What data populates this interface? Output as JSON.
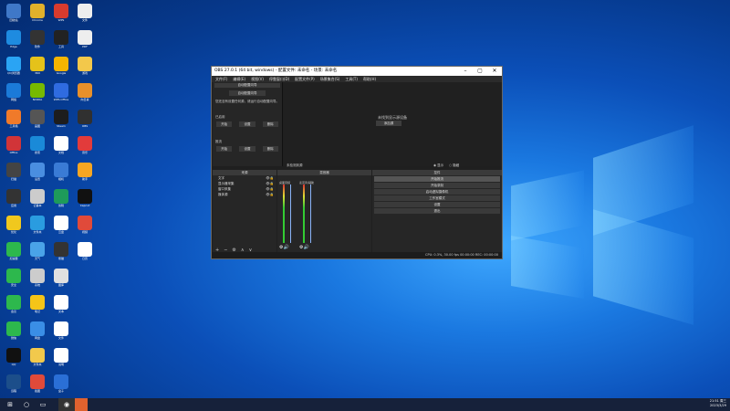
{
  "desktop": {
    "icons": [
      {
        "label": "回收站",
        "color": "#3f78c8"
      },
      {
        "label": "Chrome",
        "color": "#e0b12b"
      },
      {
        "label": "WPS",
        "color": "#d83b2e"
      },
      {
        "label": "文件",
        "color": "#eeeeee"
      },
      {
        "label": "Edge",
        "color": "#1e8be0"
      },
      {
        "label": "软件",
        "color": "#333333"
      },
      {
        "label": "工具",
        "color": "#222222"
      },
      {
        "label": "PDF",
        "color": "#eeeeee"
      },
      {
        "label": "QQ浏览器",
        "color": "#2aa4f4"
      },
      {
        "label": "360",
        "color": "#e5c21a"
      },
      {
        "label": "Google",
        "color": "#f4b400"
      },
      {
        "label": "游戏",
        "color": "#f3c84b"
      },
      {
        "label": "网络",
        "color": "#1b7ad8"
      },
      {
        "label": "NVIDIA",
        "color": "#76b900"
      },
      {
        "label": "WPS Office",
        "color": "#2f6be0"
      },
      {
        "label": "向日葵",
        "color": "#e8902a"
      },
      {
        "label": "工具箱",
        "color": "#f07a2a"
      },
      {
        "label": "画图",
        "color": "#555555"
      },
      {
        "label": "Steam",
        "color": "#1d1d1d"
      },
      {
        "label": "OBS",
        "color": "#303030"
      },
      {
        "label": "Office",
        "color": "#d13438"
      },
      {
        "label": "搜索",
        "color": "#1a8ad8"
      },
      {
        "label": "文档",
        "color": "#ffffff"
      },
      {
        "label": "音乐",
        "color": "#e23b3b"
      },
      {
        "label": "扫描",
        "color": "#444444"
      },
      {
        "label": "设置",
        "color": "#4a8ee0"
      },
      {
        "label": "相机",
        "color": "#3a7bd5"
      },
      {
        "label": "助手",
        "color": "#f6a623"
      },
      {
        "label": "应用",
        "color": "#333333"
      },
      {
        "label": "记事本",
        "color": "#cccccc"
      },
      {
        "label": "剪辑",
        "color": "#1e9b5a"
      },
      {
        "label": "Capcut",
        "color": "#111111"
      },
      {
        "label": "优化",
        "color": "#f0c81e"
      },
      {
        "label": "文件夹",
        "color": "#2a9ce0"
      },
      {
        "label": "云盘",
        "color": "#ffffff"
      },
      {
        "label": "视频",
        "color": "#e04a3a"
      },
      {
        "label": "加速器",
        "color": "#2db84d"
      },
      {
        "label": "天气",
        "color": "#4aa3e8"
      },
      {
        "label": "熊猫",
        "color": "#333333"
      },
      {
        "label": "日历",
        "color": "#ffffff"
      },
      {
        "label": "安全",
        "color": "#2db84d"
      },
      {
        "label": "系统",
        "color": "#cccccc"
      },
      {
        "label": "图库",
        "color": "#e0e0e0"
      },
      {
        "label": "",
        "color": "#00000000"
      },
      {
        "label": "会议",
        "color": "#2db84d"
      },
      {
        "label": "笔记",
        "color": "#f5c518"
      },
      {
        "label": "文本",
        "color": "#ffffff"
      },
      {
        "label": "",
        "color": "#00000000"
      },
      {
        "label": "微信",
        "color": "#2db84d"
      },
      {
        "label": "网盘",
        "color": "#3a8ee6"
      },
      {
        "label": "文件",
        "color": "#ffffff"
      },
      {
        "label": "",
        "color": "#00000000"
      },
      {
        "label": "QQ",
        "color": "#111111"
      },
      {
        "label": "文件夹",
        "color": "#f2c94c"
      },
      {
        "label": "说明",
        "color": "#ffffff"
      },
      {
        "label": "",
        "color": "#00000000"
      },
      {
        "label": "远程",
        "color": "#1c4e8a"
      },
      {
        "label": "截图",
        "color": "#e04a3a"
      },
      {
        "label": "盒子",
        "color": "#2a6fd6"
      },
      {
        "label": "",
        "color": "#00000000"
      }
    ]
  },
  "obs": {
    "title": "OBS 27.0.1 (64 bit, windows) - 配置文件: 未命名 - 场景: 未命名",
    "menu": [
      "文件(F)",
      "编辑(E)",
      "视图(V)",
      "停靠窗口(D)",
      "配置文件(P)",
      "场景集合(S)",
      "工具(T)",
      "帮助(H)"
    ],
    "wizard": {
      "header": "自动配置向导",
      "button": "自动配置向导",
      "description": "您还没有设置任何源，请运行自动配置向导。",
      "section1": "已启用",
      "section2": "推流",
      "buttons_row1": [
        "开始",
        "设置",
        "删除"
      ],
      "buttons_row2": [
        "开始",
        "设置",
        "删除"
      ]
    },
    "preview": {
      "message": "未找到显示源设备",
      "button": "添加源"
    },
    "status_line": {
      "left": "未检测到源",
      "radio1": "显示",
      "radio2": "隐藏"
    },
    "docks": {
      "scenes_title": "来源",
      "mixer_title": "混音器",
      "controls_title": "控件"
    },
    "sources": [
      {
        "label": "文字"
      },
      {
        "label": "显示器采集"
      },
      {
        "label": "窗口采集"
      },
      {
        "label": "媒体源"
      }
    ],
    "mixer": [
      {
        "label": "桌面音频"
      },
      {
        "label": "麦克风/辅助"
      }
    ],
    "controls": [
      "开始推流",
      "开始录制",
      "启动虚拟摄像机",
      "工作室模式",
      "设置",
      "退出"
    ],
    "status": "CPU: 0.3%, 30.00 fps    00:00:00    REC: 00:00:00"
  },
  "taskbar": {
    "start": "⊞",
    "search": "○",
    "taskview": "▭",
    "tray_time": "21:51 周三",
    "tray_date": "2023/3/29"
  }
}
